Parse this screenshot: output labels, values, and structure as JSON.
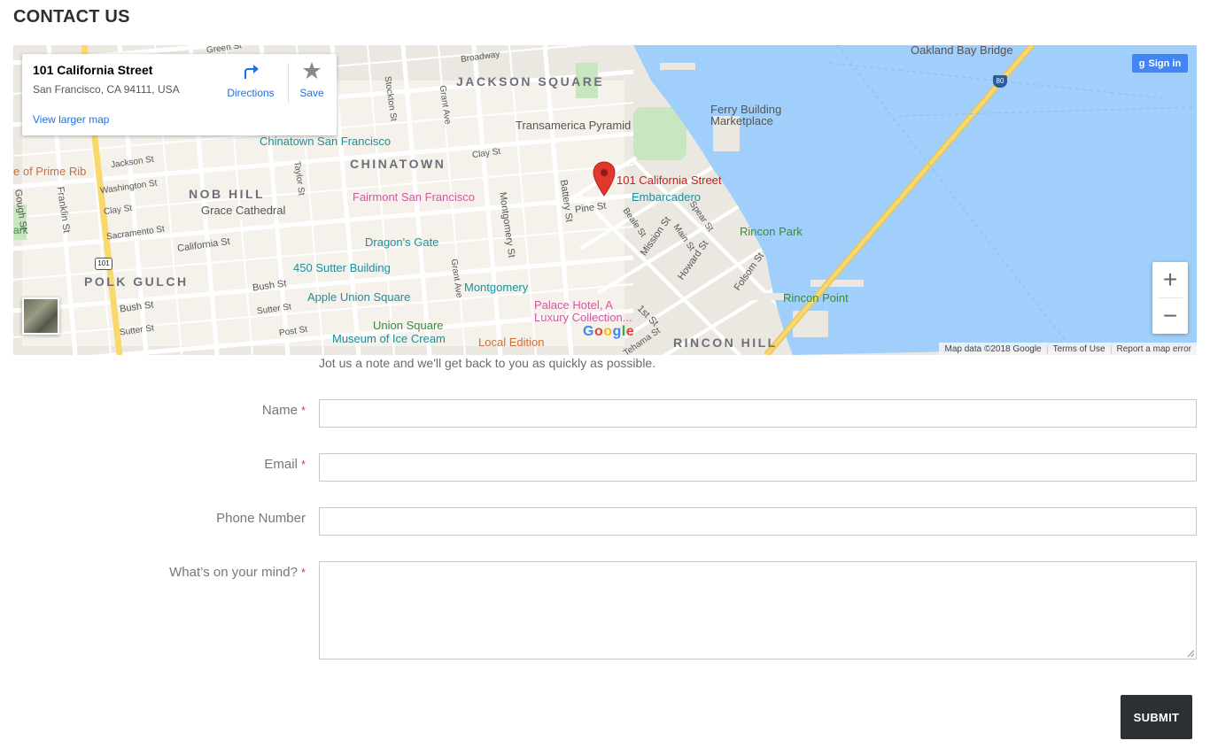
{
  "page": {
    "title": "CONTACT US"
  },
  "map": {
    "info_card": {
      "title": "101 California Street",
      "address": "San Francisco, CA 94111, USA",
      "view_larger": "View larger map",
      "directions": "Directions",
      "save": "Save"
    },
    "signin": "Sign in",
    "pin_label": "101 California Street",
    "districts": [
      "JACKSON SQUARE",
      "CHINATOWN",
      "NOB HILL",
      "POLK GULCH",
      "RINCON HILL"
    ],
    "places": {
      "chinatown_sf": "Chinatown San Francisco",
      "transamerica": "Transamerica Pyramid",
      "ferry": "Ferry Building Marketplace",
      "fairmont": "Fairmont San Francisco",
      "grace": "Grace Cathedral",
      "dragons_gate": "Dragon's Gate",
      "sutter450": "450 Sutter Building",
      "apple": "Apple Union Square",
      "montgomery": "Montgomery",
      "embarcadero": "Embarcadero",
      "rincon_park": "Rincon Park",
      "rincon_point": "Rincon Point",
      "palace": "Palace Hotel, A Luxury Collection...",
      "union_square": "Union Square",
      "ice_cream": "Museum of Ice Cream",
      "local_edition": "Local Edition",
      "prime_rib": "e of Prime Rib",
      "bay_bridge": "Oakland Bay Bridge"
    },
    "streets": {
      "broadway": "Broadway",
      "clay": "Clay St",
      "pine": "Pine St",
      "california": "California St",
      "bush": "Bush St",
      "sutter": "Sutter St",
      "post": "Post St",
      "jackson": "Jackson St",
      "washington": "Washington St",
      "sacramento": "Sacramento St",
      "mission": "Mission St",
      "howard": "Howard St",
      "folsom": "Folsom St",
      "battery": "Battery St",
      "montgomery_st": "Montgomery St",
      "first": "1st St",
      "franklin": "Franklin St",
      "gough": "Gough St",
      "green": "Green St",
      "stockton": "Stockton St",
      "grant": "Grant Ave",
      "taylor": "Taylor St",
      "beale": "Beale St",
      "main": "Main St",
      "spear": "Spear St",
      "tehama": "Tehama St",
      "ark": "ark"
    },
    "shields": {
      "us101": "101",
      "i80": "80"
    },
    "google": "Google",
    "attribution": {
      "data": "Map data ©2018 Google",
      "terms": "Terms of Use",
      "report": "Report a map error"
    },
    "zoom_in": "+",
    "zoom_out": "−"
  },
  "form": {
    "intro": "Jot us a note and we'll get back to you as quickly as possible.",
    "name_label": "Name",
    "email_label": "Email",
    "phone_label": "Phone Number",
    "mind_label": "What’s on your mind?",
    "required_mark": "*",
    "name_value": "",
    "email_value": "",
    "phone_value": "",
    "mind_value": "",
    "submit": "SUBMIT"
  },
  "colors": {
    "water": "#9fcffa",
    "land": "#ebe8e1",
    "bridge": "#f9d96d",
    "pin": "#e1372c",
    "button": "#2b3035",
    "required": "#e03b3b"
  }
}
